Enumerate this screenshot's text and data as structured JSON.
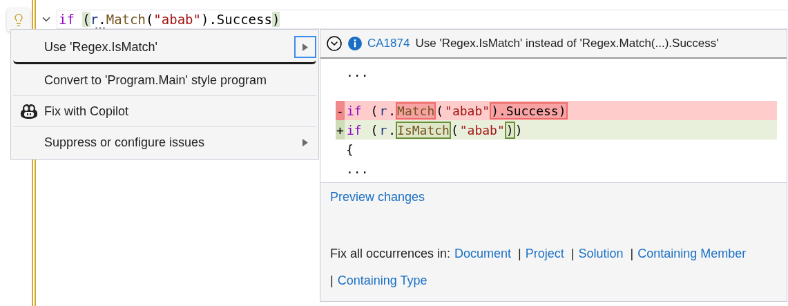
{
  "editor": {
    "code_line": [
      {
        "text": "if ",
        "kind": "keyword"
      },
      {
        "text": "(",
        "kind": "plain",
        "brace_match": true
      },
      {
        "text": "r",
        "kind": "ident"
      },
      {
        "text": ".",
        "kind": "plain"
      },
      {
        "text": "Match",
        "kind": "method"
      },
      {
        "text": "(",
        "kind": "plain"
      },
      {
        "text": "\"abab\"",
        "kind": "string"
      },
      {
        "text": ").Success",
        "kind": "plain"
      },
      {
        "text": ")",
        "kind": "plain",
        "brace_match": true
      }
    ]
  },
  "quick_actions": {
    "items": [
      {
        "label": "Use 'Regex.IsMatch'",
        "selected": true,
        "has_submenu": true,
        "has_icon": false
      },
      {
        "label": "Convert to 'Program.Main' style program",
        "selected": false,
        "has_submenu": false,
        "has_icon": false
      },
      {
        "label": "Fix with Copilot",
        "selected": false,
        "has_submenu": false,
        "has_icon": true
      },
      {
        "label": "Suppress or configure issues",
        "selected": false,
        "has_submenu": true,
        "has_icon": false
      }
    ]
  },
  "preview": {
    "diagnostic": {
      "code": "CA1874",
      "message": "Use 'Regex.IsMatch' instead of 'Regex.Match(...).Success'"
    },
    "lines": [
      {
        "kind": "context",
        "text": "..."
      },
      {
        "kind": "blank"
      },
      {
        "kind": "removed",
        "marker": "-",
        "segments": [
          {
            "text": "if",
            "kind": "keyword"
          },
          {
            "text": " (",
            "kind": "plain"
          },
          {
            "text": "r",
            "kind": "ident"
          },
          {
            "text": ".",
            "kind": "plain"
          },
          {
            "text": "Match",
            "kind": "method",
            "highlight": true
          },
          {
            "text": "(",
            "kind": "plain"
          },
          {
            "text": "\"abab\"",
            "kind": "string"
          },
          {
            "text": ").Success)",
            "kind": "plain",
            "highlight": true
          }
        ]
      },
      {
        "kind": "added",
        "marker": "+",
        "segments": [
          {
            "text": "if",
            "kind": "keyword"
          },
          {
            "text": " (",
            "kind": "plain"
          },
          {
            "text": "r",
            "kind": "ident"
          },
          {
            "text": ".",
            "kind": "plain"
          },
          {
            "text": "IsMatch",
            "kind": "method",
            "highlight": true
          },
          {
            "text": "(",
            "kind": "plain"
          },
          {
            "text": "\"abab\"",
            "kind": "string"
          },
          {
            "text": ")",
            "kind": "plain",
            "highlight": true
          },
          {
            "text": ")",
            "kind": "plain"
          }
        ]
      },
      {
        "kind": "context",
        "text": "{"
      },
      {
        "kind": "context",
        "text": "..."
      }
    ],
    "preview_link": "Preview changes",
    "fix_all": {
      "label": "Fix all occurrences in:",
      "scopes": [
        {
          "label": "Document"
        },
        {
          "separator": "|",
          "label": "Project"
        },
        {
          "separator": "|",
          "label": "Solution"
        },
        {
          "separator": "|",
          "label": "Containing Member"
        },
        {
          "separator": "|",
          "label": "Containing Type"
        }
      ]
    }
  }
}
